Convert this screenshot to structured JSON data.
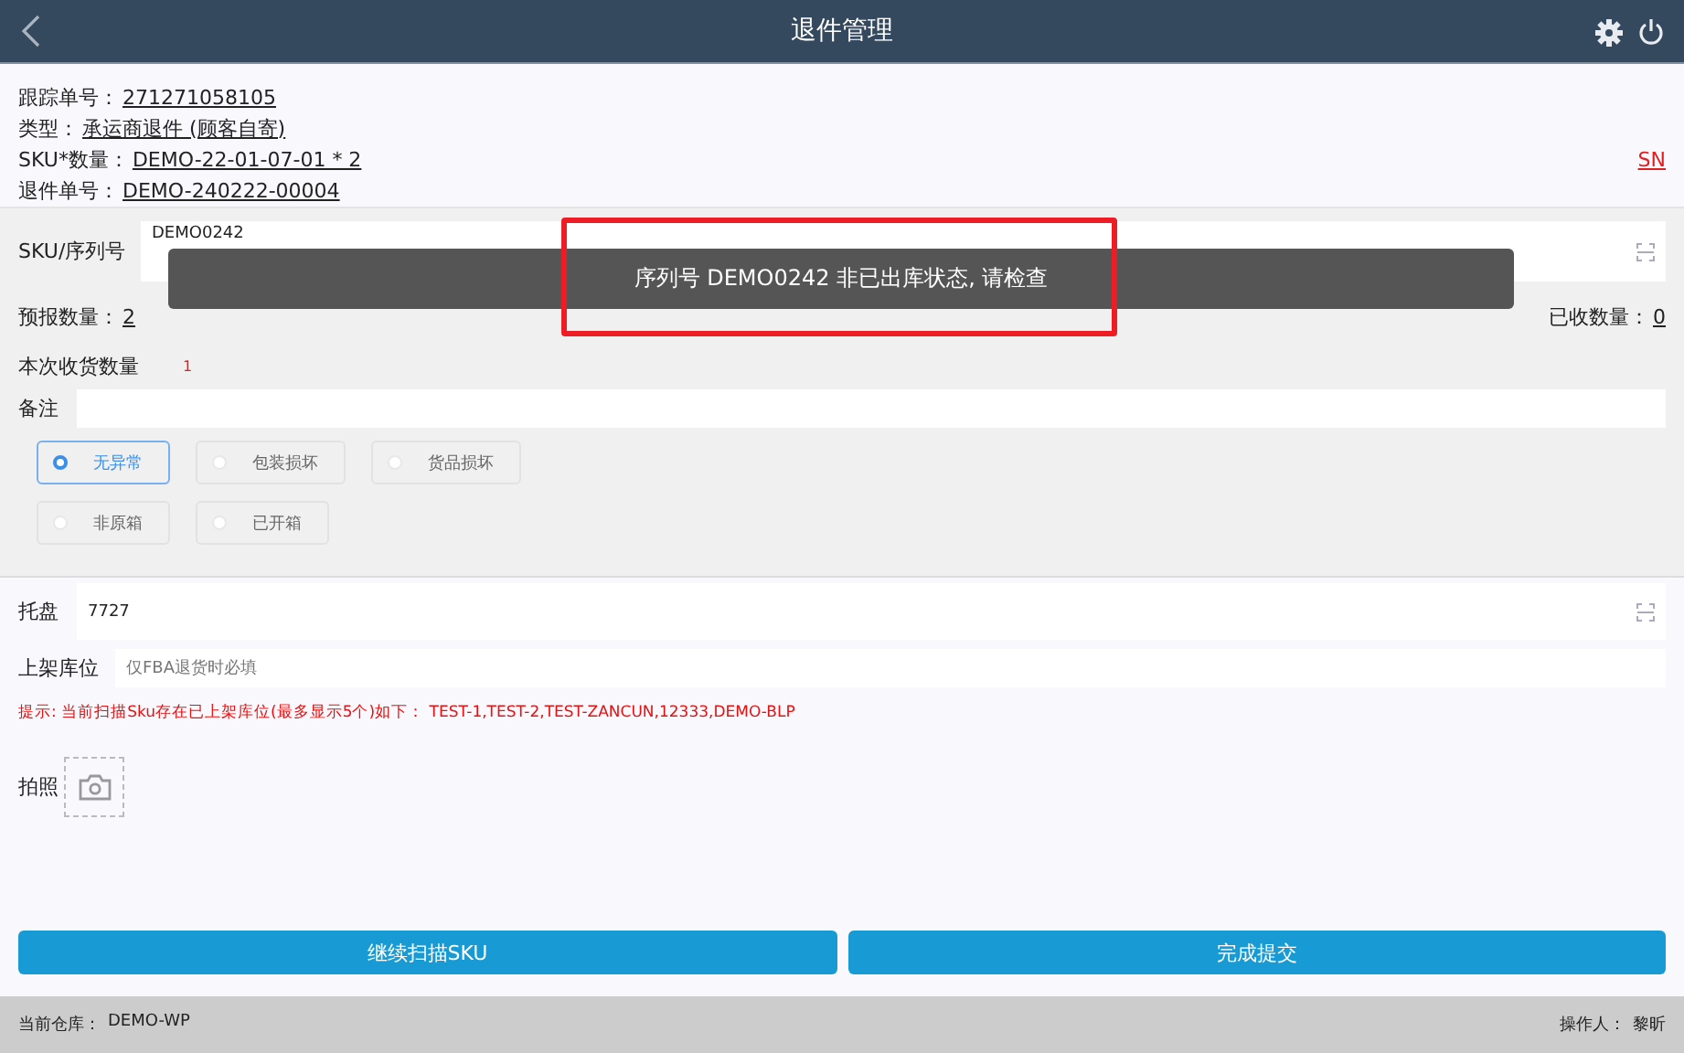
{
  "header": {
    "title": "退件管理"
  },
  "info": [
    {
      "label": "跟踪单号：",
      "value": "271271058105"
    },
    {
      "label": "类型：",
      "value": "承运商退件 (顾客自寄)"
    },
    {
      "label": "SKU*数量：",
      "value": "DEMO-22-01-07-01 * 2"
    },
    {
      "label": "退件单号：",
      "value": "DEMO-240222-00004"
    }
  ],
  "sn_link": "SN",
  "sku_field": {
    "label": "SKU/序列号",
    "value": "DEMO0242"
  },
  "forecast": {
    "label": "预报数量：",
    "value": "2"
  },
  "received": {
    "label": "已收数量：",
    "value": "0"
  },
  "this_qty": {
    "label": "本次收货数量",
    "value": "1"
  },
  "remark": {
    "label": "备注"
  },
  "conditions": [
    {
      "label": "无异常",
      "selected": true
    },
    {
      "label": "包装损坏",
      "selected": false
    },
    {
      "label": "货品损坏",
      "selected": false
    },
    {
      "label": "非原箱",
      "selected": false
    },
    {
      "label": "已开箱",
      "selected": false
    }
  ],
  "pallet": {
    "label": "托盘",
    "value": "7727"
  },
  "location": {
    "label": "上架库位",
    "placeholder": "仅FBA退货时必填"
  },
  "hint": "提示: 当前扫描Sku存在已上架库位(最多显示5个)如下：  TEST-1,TEST-2,TEST-ZANCUN,12333,DEMO-BLP",
  "photo": {
    "label": "拍照"
  },
  "buttons": [
    "继续扫描SKU",
    "完成提交"
  ],
  "footer": {
    "warehouse_label": "当前仓库：",
    "warehouse": "DEMO-WP",
    "operator_label": "操作人：",
    "operator": "黎昕"
  },
  "toast": "序列号 DEMO0242 非已出库状态, 请检查"
}
